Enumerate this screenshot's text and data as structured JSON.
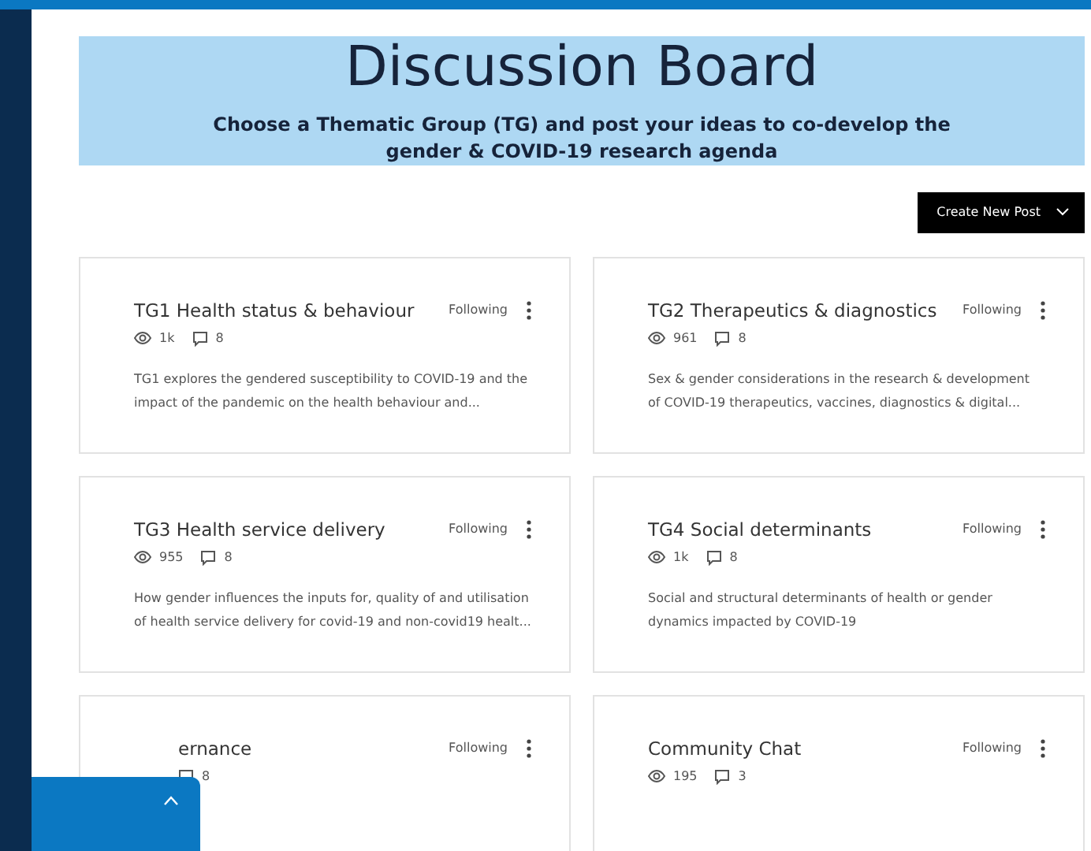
{
  "banner": {
    "title": "Discussion Board",
    "subtitle": "Choose a Thematic Group (TG) and post your ideas to co-develop the gender & COVID-19 research agenda"
  },
  "create_button": {
    "label": "Create New Post"
  },
  "categories": [
    {
      "title": "TG1 Health status & behaviour",
      "follow": "Following",
      "views": "1k",
      "comments": "8",
      "description": "TG1 explores the gendered susceptibility to COVID-19 and the impact of the pandemic on the health behaviour and...",
      "clipped": false
    },
    {
      "title": "TG2 Therapeutics & diagnostics",
      "follow": "Following",
      "views": "961",
      "comments": "8",
      "description": "Sex & gender considerations in the research & development of COVID-19 therapeutics, vaccines, diagnostics & digital...",
      "clipped": false
    },
    {
      "title": "TG3 Health service delivery",
      "follow": "Following",
      "views": "955",
      "comments": "8",
      "description": "How gender influences the inputs for, quality of and utilisation of health service delivery for covid-19 and non-covid19 healt...",
      "clipped": false
    },
    {
      "title": "TG4 Social determinants",
      "follow": "Following",
      "views": "1k",
      "comments": "8",
      "description": "Social and structural determinants of health or gender dynamics impacted by COVID-19",
      "clipped": false
    },
    {
      "title": "ernance",
      "follow": "Following",
      "comments": "8",
      "clipped": true
    },
    {
      "title": "Community Chat",
      "follow": "Following",
      "views": "195",
      "comments": "3",
      "clipped": false
    }
  ]
}
